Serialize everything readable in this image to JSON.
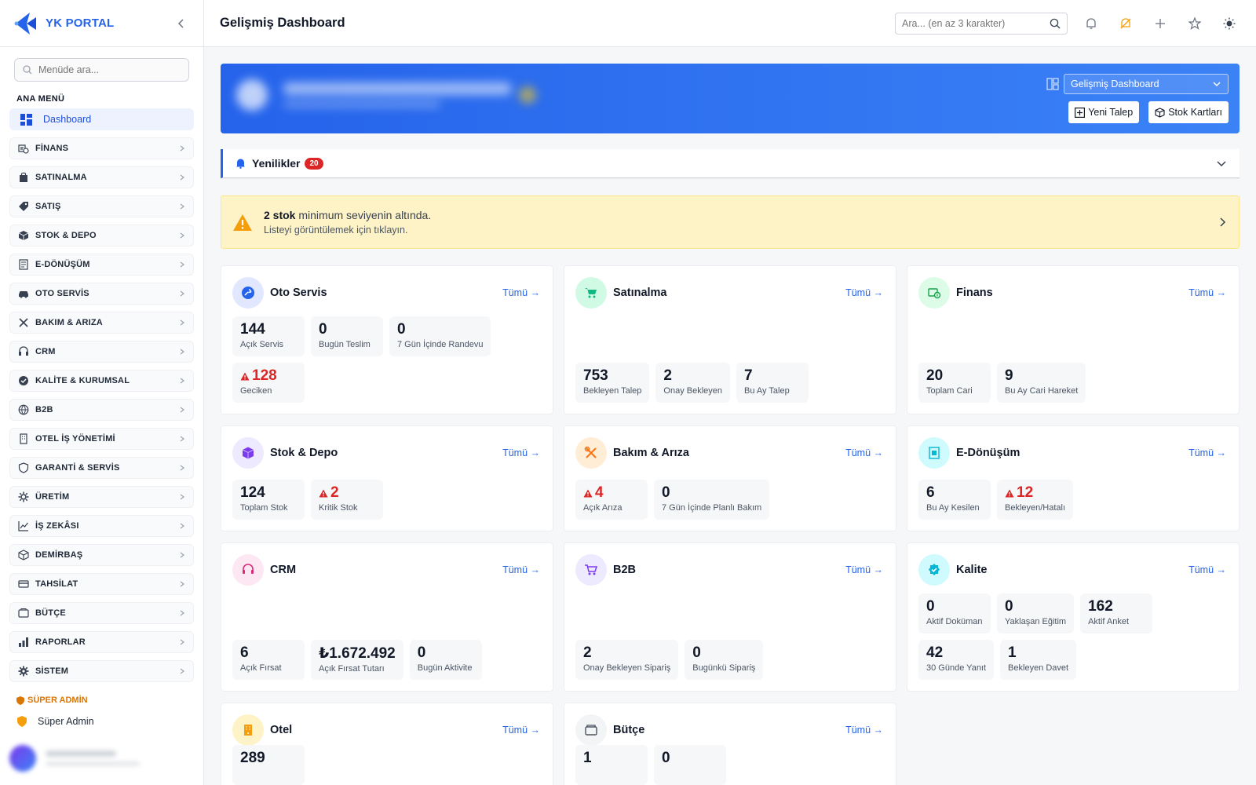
{
  "brand": {
    "name": "YK PORTAL"
  },
  "sidebar": {
    "search_placeholder": "Menüde ara...",
    "section_label": "ANA MENÜ",
    "active_item": "Dashboard",
    "items": [
      "FİNANS",
      "SATINALMA",
      "SATIŞ",
      "STOK & DEPO",
      "E-DÖNÜŞÜM",
      "OTO SERVİS",
      "BAKIM & ARIZA",
      "CRM",
      "KALİTE & KURUMSAL",
      "B2B",
      "OTEL İŞ YÖNETİMİ",
      "GARANTİ & SERVİS",
      "ÜRETİM",
      "İŞ ZEKÂSI",
      "DEMİRBAŞ",
      "TAHSİLAT",
      "BÜTÇE",
      "RAPORLAR",
      "SİSTEM"
    ],
    "super_label": "SÜPER ADMİN",
    "super_item": "Süper Admin"
  },
  "topbar": {
    "title": "Gelişmiş Dashboard",
    "search_placeholder": "Ara... (en az 3 karakter)"
  },
  "hero": {
    "select_value": "Gelişmiş Dashboard",
    "btn_new": "Yeni Talep",
    "btn_stock": "Stok Kartları"
  },
  "news": {
    "label": "Yenilikler",
    "count": "20"
  },
  "alert": {
    "bold": "2 stok",
    "rest": " minimum seviyenin altında.",
    "sub": "Listeyi görüntülemek için tıklayın."
  },
  "colors": {
    "accent": "#2563eb",
    "danger": "#dc2626",
    "warning_bg": "#fef3c7"
  },
  "cards": [
    {
      "title": "Oto Servis",
      "more": "Tümü →",
      "icon": "wrench-circle-icon",
      "stats": [
        {
          "v": "144",
          "l": "Açık Servis"
        },
        {
          "v": "0",
          "l": "Bugün Teslim"
        },
        {
          "v": "0",
          "l": "7 Gün İçinde Randevu"
        },
        {
          "v": "128",
          "l": "Geciken",
          "warn": true
        }
      ]
    },
    {
      "title": "Satınalma",
      "more": "Tümü →",
      "icon": "cart-icon",
      "stats": [
        {
          "v": "753",
          "l": "Bekleyen Talep"
        },
        {
          "v": "2",
          "l": "Onay Bekleyen"
        },
        {
          "v": "7",
          "l": "Bu Ay Talep"
        }
      ]
    },
    {
      "title": "Finans",
      "more": "Tümü →",
      "icon": "money-icon",
      "stats": [
        {
          "v": "20",
          "l": "Toplam Cari"
        },
        {
          "v": "9",
          "l": "Bu Ay Cari Hareket"
        }
      ]
    },
    {
      "title": "Stok & Depo",
      "more": "Tümü →",
      "icon": "box-icon",
      "stats": [
        {
          "v": "124",
          "l": "Toplam Stok"
        },
        {
          "v": "2",
          "l": "Kritik Stok",
          "warn": true
        }
      ]
    },
    {
      "title": "Bakım & Arıza",
      "more": "Tümü →",
      "icon": "tools-icon",
      "stats": [
        {
          "v": "4",
          "l": "Açık Arıza",
          "warn": true
        },
        {
          "v": "0",
          "l": "7 Gün İçinde Planlı Bakım"
        }
      ]
    },
    {
      "title": "E-Dönüşüm",
      "more": "Tümü →",
      "icon": "document-icon",
      "stats": [
        {
          "v": "6",
          "l": "Bu Ay Kesilen"
        },
        {
          "v": "12",
          "l": "Bekleyen/Hatalı",
          "warn": true
        }
      ]
    },
    {
      "title": "CRM",
      "more": "Tümü →",
      "icon": "headset-icon",
      "stats": [
        {
          "v": "6",
          "l": "Açık Fırsat"
        },
        {
          "v": "₺1.672.492",
          "l": "Açık Fırsat Tutarı"
        },
        {
          "v": "0",
          "l": "Bugün Aktivite"
        }
      ]
    },
    {
      "title": "B2B",
      "more": "Tümü →",
      "icon": "basket-icon",
      "stats": [
        {
          "v": "2",
          "l": "Onay Bekleyen Sipariş"
        },
        {
          "v": "0",
          "l": "Bugünkü Sipariş"
        }
      ]
    },
    {
      "title": "Kalite",
      "more": "Tümü →",
      "icon": "badge-check-icon",
      "stats": [
        {
          "v": "0",
          "l": "Aktif Doküman"
        },
        {
          "v": "0",
          "l": "Yaklaşan Eğitim"
        },
        {
          "v": "162",
          "l": "Aktif Anket"
        },
        {
          "v": "42",
          "l": "30 Günde Yanıt"
        },
        {
          "v": "1",
          "l": "Bekleyen Davet"
        }
      ]
    },
    {
      "title": "Otel",
      "more": "Tümü →",
      "icon": "building-icon",
      "stats": [
        {
          "v": "289",
          "l": ""
        }
      ]
    },
    {
      "title": "Bütçe",
      "more": "Tümü →",
      "icon": "wallet-icon",
      "stats": [
        {
          "v": "1",
          "l": ""
        },
        {
          "v": "0",
          "l": ""
        }
      ]
    }
  ]
}
